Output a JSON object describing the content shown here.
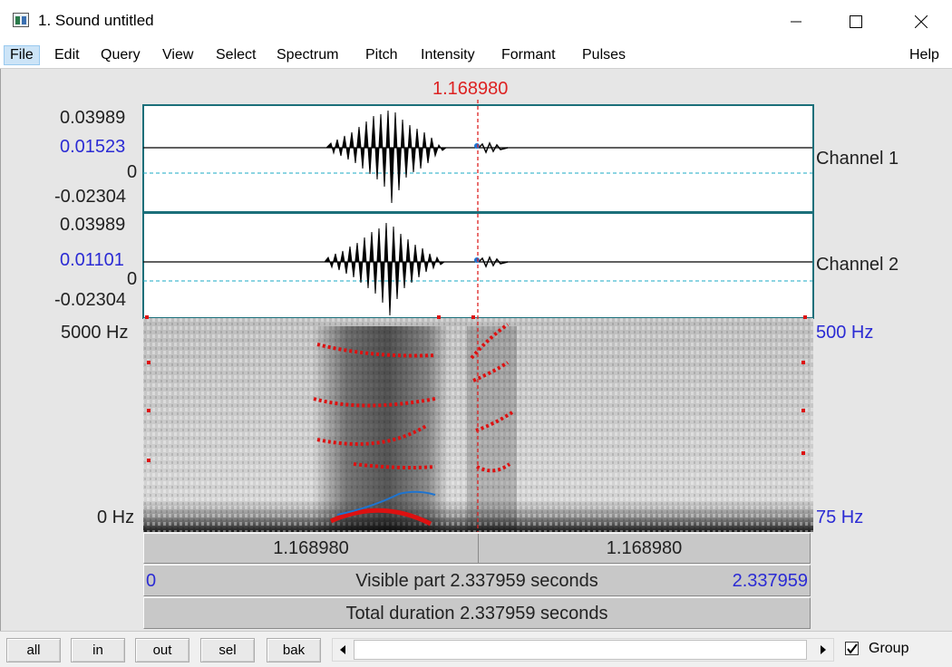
{
  "window": {
    "title": "1. Sound untitled"
  },
  "menu": {
    "items": [
      "File",
      "Edit",
      "Query",
      "View",
      "Select",
      "Spectrum",
      "Pitch",
      "Intensity",
      "Formant",
      "Pulses"
    ],
    "help": "Help"
  },
  "cursor": {
    "time": "1.168980"
  },
  "channel1": {
    "label": "Channel 1",
    "max": "0.03989",
    "value": "0.01523",
    "zero": "0",
    "min": "-0.02304"
  },
  "channel2": {
    "label": "Channel 2",
    "max": "0.03989",
    "value": "0.01101",
    "zero": "0",
    "min": "-0.02304"
  },
  "spectrogram": {
    "top_freq": "5000 Hz",
    "bottom_freq": "0 Hz",
    "pitch_top": "500 Hz",
    "pitch_bottom": "75 Hz"
  },
  "timebar": {
    "left_part": "1.168980",
    "right_part": "1.168980",
    "visible_start": "0",
    "visible_text": "Visible part 2.337959 seconds",
    "visible_end": "2.337959",
    "total_text": "Total duration 2.337959 seconds"
  },
  "buttons": {
    "all": "all",
    "in": "in",
    "out": "out",
    "sel": "sel",
    "bak": "bak"
  },
  "group": {
    "label": "Group",
    "checked": true
  },
  "colors": {
    "cursor": "#dd2222",
    "formant": "#dd1111",
    "pitch": "#1e74d0",
    "value_label": "#2b2bd4"
  }
}
